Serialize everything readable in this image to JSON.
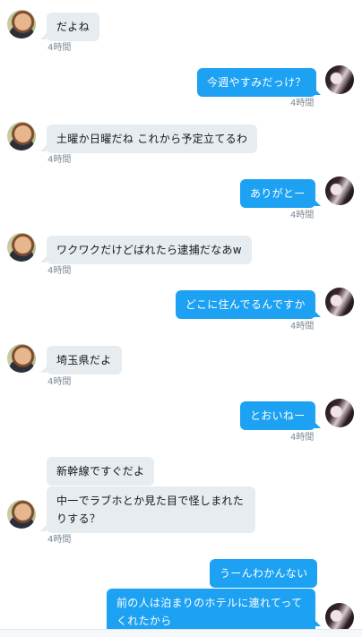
{
  "conversation": {
    "messages": [
      {
        "text": "だよね",
        "time": "4時間"
      },
      {
        "text": "今週やすみだっけ？",
        "time": "4時間"
      },
      {
        "text": "土曜か日曜だね これから予定立てるわ",
        "time": "4時間"
      },
      {
        "text": "ありがとー",
        "time": "4時間"
      },
      {
        "text": "ワクワクだけどばれたら逮捕だなあw",
        "time": "4時間"
      },
      {
        "text": "どこに住んでるんですか",
        "time": "4時間"
      },
      {
        "text": "埼玉県だよ",
        "time": "4時間"
      },
      {
        "text": "とおいねー",
        "time": "4時間"
      },
      {
        "text": "新幹線ですぐだよ"
      },
      {
        "text": "中一でラブホとか見た目で怪しまれたりする？",
        "time": "4時間"
      },
      {
        "text": "うーんわかんない"
      },
      {
        "text": "前の人は泊まりのホテルに連れてってくれたから"
      }
    ]
  },
  "colors": {
    "incoming_bubble": "#e6ecf0",
    "outgoing_bubble": "#1da1f2",
    "timestamp": "#7c8a96"
  }
}
